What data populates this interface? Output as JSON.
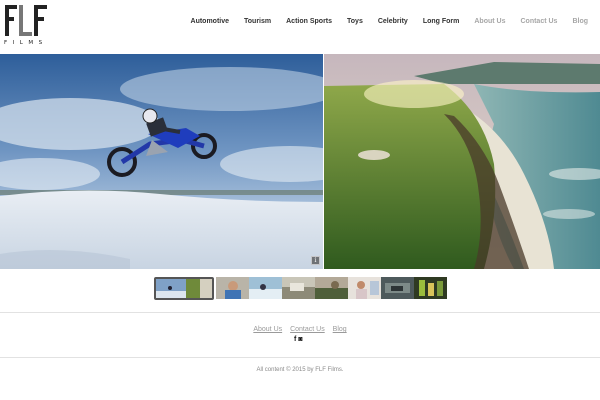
{
  "brand": {
    "logo_letters": "FLF",
    "logo_subtext": "FILMS"
  },
  "nav": {
    "items": [
      {
        "label": "Automotive"
      },
      {
        "label": "Tourism"
      },
      {
        "label": "Action Sports"
      },
      {
        "label": "Toys"
      },
      {
        "label": "Celebrity"
      },
      {
        "label": "Long Form"
      },
      {
        "label": "About Us"
      },
      {
        "label": "Contact Us"
      },
      {
        "label": "Blog"
      }
    ]
  },
  "hero": {
    "info_label": "i"
  },
  "thumbnails": {
    "count": 9
  },
  "footer": {
    "links": [
      {
        "label": "About Us"
      },
      {
        "label": "Contact Us"
      },
      {
        "label": "Blog"
      }
    ],
    "social": {
      "facebook": "f",
      "instagram": "◙"
    },
    "copyright": "All content © 2015 by FLF Films."
  },
  "colors": {
    "nav_text": "#333333",
    "nav_muted": "#a7a7a7",
    "footer_link": "#9a9a9a"
  }
}
